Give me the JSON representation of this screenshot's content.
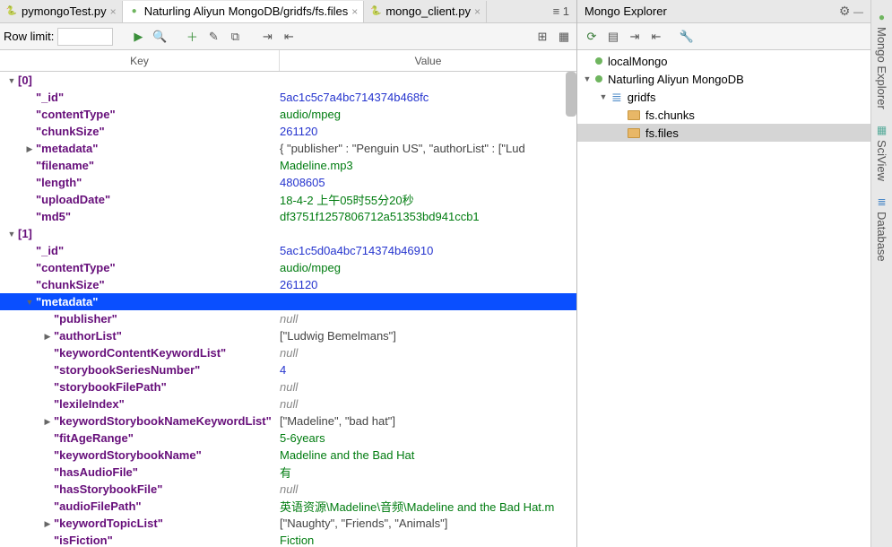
{
  "tabs": [
    {
      "label": "pymongoTest.py",
      "icon": "🐍",
      "active": false
    },
    {
      "label": "Naturling Aliyun MongoDB/gridfs/fs.files",
      "icon": "●",
      "iconColor": "#6fb55f",
      "active": true
    },
    {
      "label": "mongo_client.py",
      "icon": "🐍",
      "active": false
    }
  ],
  "tabs_overflow": "≡ 1",
  "toolbar": {
    "row_limit_label": "Row limit:",
    "row_limit_value": ""
  },
  "table": {
    "col_key": "Key",
    "col_val": "Value",
    "rows": [
      {
        "indent": 0,
        "tw": "▼",
        "key": "[0]",
        "val": "",
        "vc": ""
      },
      {
        "indent": 1,
        "tw": "",
        "key": "\"_id\"",
        "val": "5ac1c5c7a4bc714374b468fc",
        "vc": "v-blue"
      },
      {
        "indent": 1,
        "tw": "",
        "key": "\"contentType\"",
        "val": "audio/mpeg",
        "vc": "v-green"
      },
      {
        "indent": 1,
        "tw": "",
        "key": "\"chunkSize\"",
        "val": "261120",
        "vc": "v-blue"
      },
      {
        "indent": 1,
        "tw": "▶",
        "key": "\"metadata\"",
        "val": "{ \"publisher\" : \"Penguin US\", \"authorList\" : [\"Lud",
        "vc": "v-obj"
      },
      {
        "indent": 1,
        "tw": "",
        "key": "\"filename\"",
        "val": "Madeline.mp3",
        "vc": "v-green"
      },
      {
        "indent": 1,
        "tw": "",
        "key": "\"length\"",
        "val": "4808605",
        "vc": "v-blue"
      },
      {
        "indent": 1,
        "tw": "",
        "key": "\"uploadDate\"",
        "val": "18-4-2 上午05时55分20秒",
        "vc": "v-green"
      },
      {
        "indent": 1,
        "tw": "",
        "key": "\"md5\"",
        "val": "df3751f1257806712a51353bd941ccb1",
        "vc": "v-green"
      },
      {
        "indent": 0,
        "tw": "▼",
        "key": "[1]",
        "val": "",
        "vc": ""
      },
      {
        "indent": 1,
        "tw": "",
        "key": "\"_id\"",
        "val": "5ac1c5d0a4bc714374b46910",
        "vc": "v-blue"
      },
      {
        "indent": 1,
        "tw": "",
        "key": "\"contentType\"",
        "val": "audio/mpeg",
        "vc": "v-green"
      },
      {
        "indent": 1,
        "tw": "",
        "key": "\"chunkSize\"",
        "val": "261120",
        "vc": "v-blue"
      },
      {
        "indent": 1,
        "tw": "▼",
        "key": "\"metadata\"",
        "val": "",
        "vc": "",
        "selected": true
      },
      {
        "indent": 2,
        "tw": "",
        "key": "\"publisher\"",
        "val": "null",
        "vc": "v-null"
      },
      {
        "indent": 2,
        "tw": "▶",
        "key": "\"authorList\"",
        "val": "[\"Ludwig Bemelmans\"]",
        "vc": "v-obj"
      },
      {
        "indent": 2,
        "tw": "",
        "key": "\"keywordContentKeywordList\"",
        "val": "null",
        "vc": "v-null"
      },
      {
        "indent": 2,
        "tw": "",
        "key": "\"storybookSeriesNumber\"",
        "val": "4",
        "vc": "v-blue"
      },
      {
        "indent": 2,
        "tw": "",
        "key": "\"storybookFilePath\"",
        "val": "null",
        "vc": "v-null"
      },
      {
        "indent": 2,
        "tw": "",
        "key": "\"lexileIndex\"",
        "val": "null",
        "vc": "v-null"
      },
      {
        "indent": 2,
        "tw": "▶",
        "key": "\"keywordStorybookNameKeywordList\"",
        "val": "[\"Madeline\", \"bad hat\"]",
        "vc": "v-obj"
      },
      {
        "indent": 2,
        "tw": "",
        "key": "\"fitAgeRange\"",
        "val": "5-6years",
        "vc": "v-green"
      },
      {
        "indent": 2,
        "tw": "",
        "key": "\"keywordStorybookName\"",
        "val": "Madeline and the Bad Hat",
        "vc": "v-green"
      },
      {
        "indent": 2,
        "tw": "",
        "key": "\"hasAudioFile\"",
        "val": "有",
        "vc": "v-green"
      },
      {
        "indent": 2,
        "tw": "",
        "key": "\"hasStorybookFile\"",
        "val": "null",
        "vc": "v-null"
      },
      {
        "indent": 2,
        "tw": "",
        "key": "\"audioFilePath\"",
        "val": "英语资源\\Madeline\\音频\\Madeline and the Bad Hat.m",
        "vc": "v-green"
      },
      {
        "indent": 2,
        "tw": "▶",
        "key": "\"keywordTopicList\"",
        "val": "[\"Naughty\", \"Friends\", \"Animals\"]",
        "vc": "v-obj"
      },
      {
        "indent": 2,
        "tw": "",
        "key": "\"isFiction\"",
        "val": "Fiction",
        "vc": "v-green"
      }
    ]
  },
  "explorer": {
    "title": "Mongo Explorer",
    "tree": [
      {
        "indent": 0,
        "tw": "",
        "icon": "leaf",
        "label": "localMongo"
      },
      {
        "indent": 0,
        "tw": "▼",
        "icon": "leaf",
        "label": "Naturling Aliyun MongoDB"
      },
      {
        "indent": 1,
        "tw": "▼",
        "icon": "db",
        "label": "gridfs"
      },
      {
        "indent": 2,
        "tw": "",
        "icon": "folder",
        "label": "fs.chunks"
      },
      {
        "indent": 2,
        "tw": "",
        "icon": "folder",
        "label": "fs.files",
        "selected": true
      }
    ]
  },
  "sidebar": {
    "tabs": [
      {
        "label": "Mongo Explorer",
        "icon": "●",
        "iconColor": "#6fb55f"
      },
      {
        "label": "SciView",
        "icon": "▦",
        "iconColor": "#5a9"
      },
      {
        "label": "Database",
        "icon": "≣",
        "iconColor": "#4a88c7"
      }
    ]
  }
}
